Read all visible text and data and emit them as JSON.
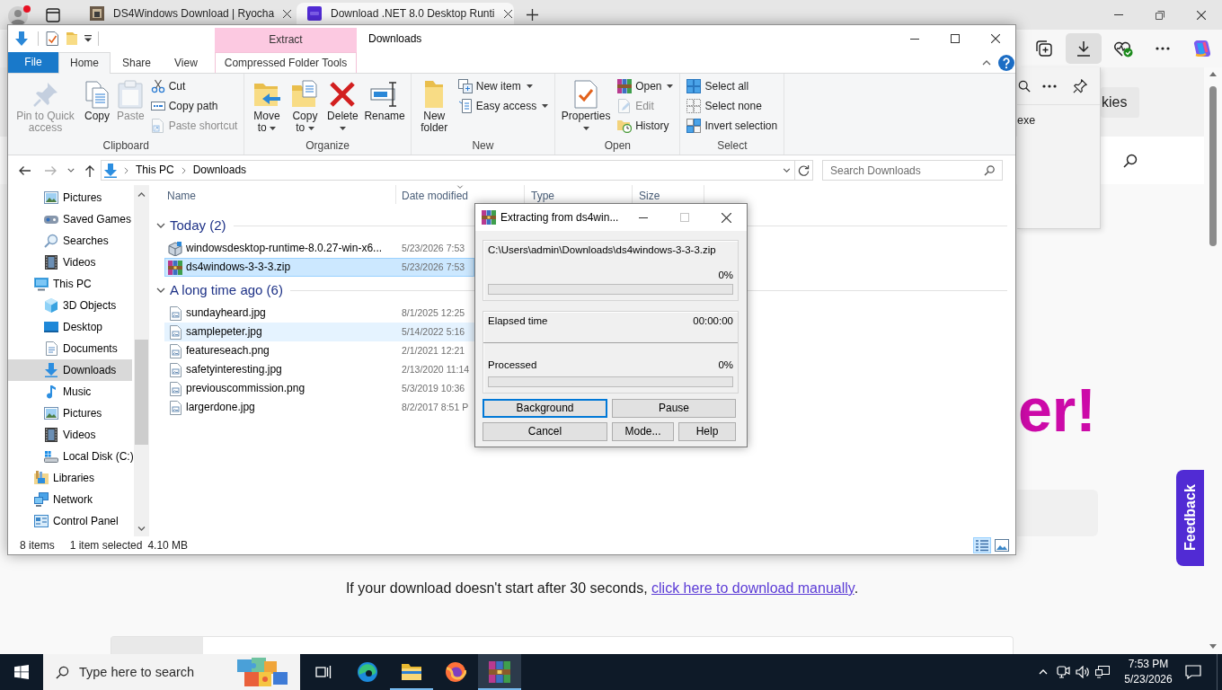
{
  "browser": {
    "tabs": [
      {
        "title": "DS4Windows Download | Ryocha",
        "kind": "photo",
        "selected": false
      },
      {
        "title": "Download .NET 8.0 Desktop Runti",
        "kind": "logo",
        "selected": true
      }
    ],
    "toolbar": [
      {
        "kind": "collections",
        "selected": false
      },
      {
        "kind": "downloads",
        "selected": true
      },
      {
        "kind": "essentials",
        "selected": false
      },
      {
        "kind": "more",
        "selected": false
      },
      {
        "kind": "copilot",
        "selected": false
      }
    ],
    "downloads_panel": {
      "item": "exe"
    },
    "page": {
      "button": "kies",
      "heading": "er!",
      "feedback": "Feedback",
      "notice": {
        "text": "If your download doesn't start after 30 seconds, ",
        "link": "click here to download manually",
        "end": "."
      }
    }
  },
  "explorer": {
    "title": "Downloads",
    "context_header": "Extract",
    "ribbon_tabs": [
      {
        "label": "File",
        "kind": "file",
        "selected": false
      },
      {
        "label": "Home",
        "kind": "tab",
        "selected": true
      },
      {
        "label": "Share",
        "kind": "tab",
        "selected": false
      },
      {
        "label": "View",
        "kind": "tab",
        "selected": false
      },
      {
        "label": "Compressed Folder Tools",
        "kind": "context",
        "selected": false
      }
    ],
    "ribbon_groups": [
      {
        "label": "Clipboard",
        "large": [
          {
            "label": "Pin to Quick access",
            "kind": "pin",
            "disabled": true,
            "dropdown": false
          },
          {
            "label": "Copy",
            "kind": "copy",
            "disabled": false,
            "dropdown": false
          },
          {
            "label": "Paste",
            "kind": "paste",
            "disabled": true,
            "dropdown": false
          }
        ],
        "small": [
          {
            "label": "Cut",
            "kind": "cut",
            "disabled": false,
            "dropdown": false
          },
          {
            "label": "Copy path",
            "kind": "copypath",
            "disabled": false,
            "dropdown": false
          },
          {
            "label": "Paste shortcut",
            "kind": "shortcut",
            "disabled": true,
            "dropdown": false
          }
        ]
      },
      {
        "label": "Organize",
        "large": [
          {
            "label": "Move to",
            "kind": "moveto",
            "disabled": false,
            "dropdown": true
          },
          {
            "label": "Copy to",
            "kind": "copyto",
            "disabled": false,
            "dropdown": true
          },
          {
            "label": "Delete",
            "kind": "delete",
            "disabled": false,
            "dropdown": true
          },
          {
            "label": "Rename",
            "kind": "rename",
            "disabled": false,
            "dropdown": false
          }
        ]
      },
      {
        "label": "New",
        "large": [
          {
            "label": "New folder",
            "kind": "newfolder",
            "disabled": false,
            "dropdown": false
          }
        ],
        "small": [
          {
            "label": "New item",
            "kind": "newitem",
            "disabled": false,
            "dropdown": true
          },
          {
            "label": "Easy access",
            "kind": "easyaccess",
            "disabled": false,
            "dropdown": true
          }
        ]
      },
      {
        "label": "Open",
        "large": [
          {
            "label": "Properties",
            "kind": "properties",
            "disabled": false,
            "dropdown": true
          }
        ],
        "small": [
          {
            "label": "Open",
            "kind": "open",
            "disabled": false,
            "dropdown": true
          },
          {
            "label": "Edit",
            "kind": "edit",
            "disabled": true,
            "dropdown": false
          },
          {
            "label": "History",
            "kind": "history",
            "disabled": false,
            "dropdown": false
          }
        ]
      },
      {
        "label": "Select",
        "small": [
          {
            "label": "Select all",
            "kind": "selectall",
            "disabled": false,
            "dropdown": false
          },
          {
            "label": "Select none",
            "kind": "selectnone",
            "disabled": false,
            "dropdown": false
          },
          {
            "label": "Invert selection",
            "kind": "invert",
            "disabled": false,
            "dropdown": false
          }
        ]
      }
    ],
    "address": {
      "path": [
        "This PC",
        "Downloads"
      ],
      "search_placeholder": "Search Downloads"
    },
    "nav_pane": {
      "items": [
        {
          "children": [
            {
              "label": "Pictures",
              "kind": "pictures",
              "selected": false
            },
            {
              "label": "Saved Games",
              "kind": "games",
              "selected": false
            },
            {
              "label": "Searches",
              "kind": "searches",
              "selected": false
            },
            {
              "label": "Videos",
              "kind": "videos",
              "selected": false
            }
          ]
        },
        {
          "label": "This PC",
          "kind": "pc",
          "selected": false,
          "children": [
            {
              "label": "3D Objects",
              "kind": "objects",
              "selected": false
            },
            {
              "label": "Desktop",
              "kind": "desktop",
              "selected": false
            },
            {
              "label": "Documents",
              "kind": "documents",
              "selected": false
            },
            {
              "label": "Downloads",
              "kind": "downloads",
              "selected": true
            },
            {
              "label": "Music",
              "kind": "music",
              "selected": false
            },
            {
              "label": "Pictures",
              "kind": "pictures",
              "selected": false
            },
            {
              "label": "Videos",
              "kind": "videos",
              "selected": false
            },
            {
              "label": "Local Disk (C:)",
              "kind": "disk",
              "selected": false
            }
          ]
        },
        {
          "label": "Libraries",
          "kind": "libraries",
          "selected": false
        },
        {
          "label": "Network",
          "kind": "network",
          "selected": false
        },
        {
          "label": "Control Panel",
          "kind": "control",
          "selected": false
        }
      ]
    },
    "columns": [
      "Name",
      "Date modified",
      "Type",
      "Size"
    ],
    "groups": [
      {
        "label": "Today (2)",
        "expanded": true,
        "files": [
          {
            "name": "windowsdesktop-runtime-8.0.27-win-x6...",
            "date": "5/23/2026 7:53",
            "kind": "installer",
            "selected": false,
            "hovered": false
          },
          {
            "name": "ds4windows-3-3-3.zip",
            "date": "5/23/2026 7:53",
            "kind": "archive",
            "selected": true,
            "hovered": false
          }
        ]
      },
      {
        "label": "A long time ago (6)",
        "expanded": true,
        "files": [
          {
            "name": "sundayheard.jpg",
            "date": "8/1/2025 12:25",
            "kind": "image",
            "selected": false,
            "hovered": false
          },
          {
            "name": "samplepeter.jpg",
            "date": "5/14/2022 5:16",
            "kind": "image",
            "selected": false,
            "hovered": true
          },
          {
            "name": "featureseach.png",
            "date": "2/1/2021 12:21",
            "kind": "image",
            "selected": false,
            "hovered": false
          },
          {
            "name": "safetyinteresting.jpg",
            "date": "2/13/2020 11:14",
            "kind": "image",
            "selected": false,
            "hovered": false
          },
          {
            "name": "previouscommission.png",
            "date": "5/3/2019 10:36",
            "kind": "image",
            "selected": false,
            "hovered": false
          },
          {
            "name": "largerdone.jpg",
            "date": "8/2/2017 8:51 P",
            "kind": "image",
            "selected": false,
            "hovered": false
          }
        ]
      }
    ],
    "status": {
      "count": "8 items",
      "selection": "1 item selected",
      "size": "4.10 MB"
    },
    "views": [
      {
        "kind": "details",
        "selected": true
      },
      {
        "kind": "tiles",
        "selected": false
      }
    ]
  },
  "extract_dialog": {
    "title": "Extracting from ds4win...",
    "maximize_disabled": true,
    "archive": {
      "path": "C:\\Users\\admin\\Downloads\\ds4windows-3-3-3.zip",
      "reading": "0%",
      "level": 0
    },
    "elapsed": {
      "label": "Elapsed time",
      "value": "00:00:00"
    },
    "processed": {
      "label": "Processed",
      "reading": "0%",
      "level": 0
    },
    "buttons": [
      {
        "label": "Background",
        "focused": true
      },
      {
        "label": "Pause",
        "focused": false
      },
      {
        "label": "Cancel",
        "focused": false
      },
      {
        "label": "Mode...",
        "focused": false
      },
      {
        "label": "Help",
        "focused": false
      }
    ]
  },
  "taskbar": {
    "search_placeholder": "Type here to search",
    "apps": [
      {
        "kind": "edge",
        "running": false,
        "active": false
      },
      {
        "kind": "explorer",
        "running": true,
        "active": false
      },
      {
        "kind": "firefox",
        "running": false,
        "active": false
      },
      {
        "kind": "winrar",
        "running": true,
        "active": true
      }
    ],
    "time": "7:53 PM",
    "date": "5/23/2026"
  }
}
